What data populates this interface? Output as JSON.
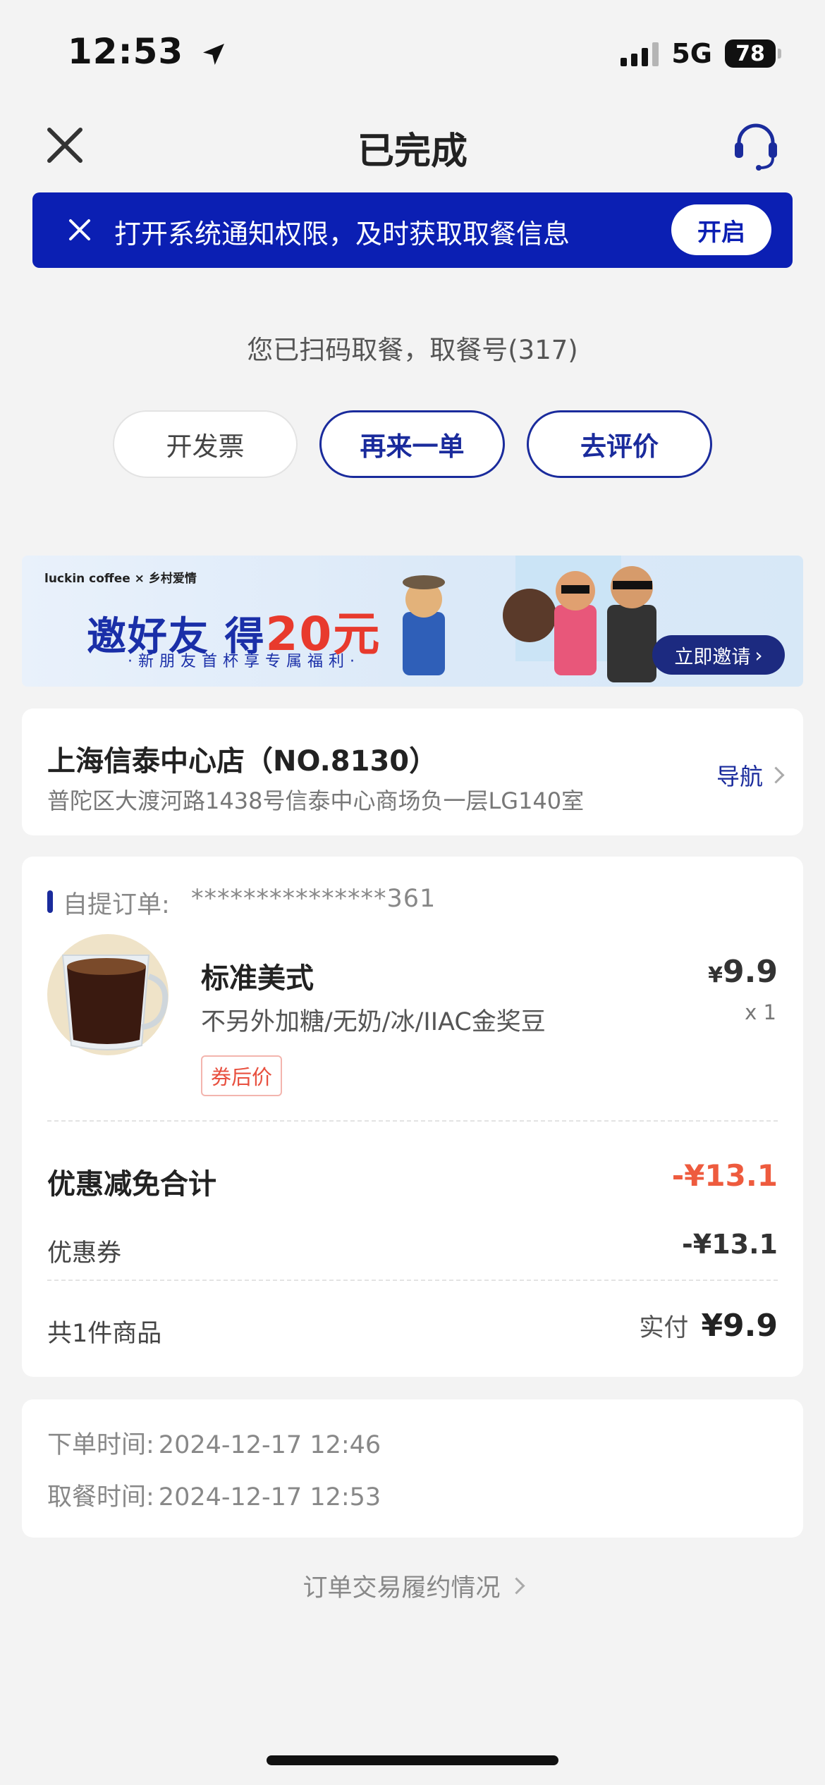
{
  "status_bar": {
    "time": "12:53",
    "network": "5G",
    "battery": "78"
  },
  "header": {
    "title": "已完成"
  },
  "notice": {
    "text": "打开系统通知权限，及时获取取餐信息",
    "button": "开启"
  },
  "pickup_info": "您已扫码取餐，取餐号(317)",
  "actions": {
    "invoice": "开发票",
    "reorder": "再来一单",
    "review": "去评价"
  },
  "promo": {
    "brand": "luckin coffee × 乡村爱情",
    "title_prefix": "邀好友 得",
    "title_amount": "20元",
    "subtitle": "·新朋友首杯享专属福利·",
    "button": "立即邀请"
  },
  "store": {
    "name": "上海信泰中心店（NO.8130）",
    "address": "普陀区大渡河路1438号信泰中心商场负一层LG140室",
    "nav": "导航"
  },
  "order": {
    "label": "自提订单:",
    "number": "***************361",
    "item": {
      "name": "标准美式",
      "spec": "不另外加糖/无奶/冰/IIAC金奖豆",
      "tag": "券后价",
      "price_symbol": "¥",
      "price": "9.9",
      "qty": "x 1"
    },
    "discount_total_label": "优惠减免合计",
    "discount_total_value": "-¥13.1",
    "coupon_label": "优惠券",
    "coupon_value": "-¥13.1",
    "count_label": "共1件商品",
    "paid_label": "实付",
    "paid_value": "¥9.9"
  },
  "times": {
    "order_label": "下单时间:",
    "order_value": "2024-12-17 12:46",
    "pickup_label": "取餐时间:",
    "pickup_value": "2024-12-17 12:53"
  },
  "fulfilment_link": "订单交易履约情况",
  "colors": {
    "brand_blue": "#0b1fb3",
    "accent_red": "#ee5b3e",
    "background": "#f3f3f3"
  }
}
